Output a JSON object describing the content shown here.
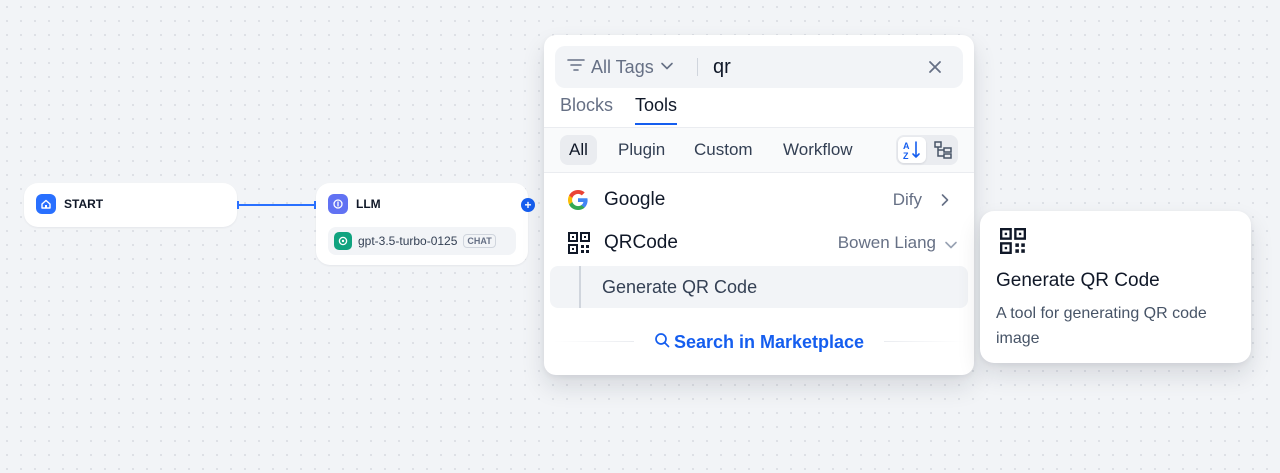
{
  "canvas": {
    "start_node": {
      "title": "START",
      "icon": "home-icon",
      "color": "#2970ff"
    },
    "llm_node": {
      "title": "LLM",
      "icon": "llm-brain-icon",
      "color": "#6172f3",
      "model_icon": "openai-icon",
      "model_name": "gpt-3.5-turbo-0125",
      "model_badge": "CHAT"
    },
    "edge_color": "#2970ff"
  },
  "selector": {
    "tags_label": "All Tags",
    "search_value": "qr",
    "main_tabs": [
      {
        "label": "Blocks",
        "active": false
      },
      {
        "label": "Tools",
        "active": true
      }
    ],
    "sub_tabs": [
      {
        "label": "All",
        "active": true
      },
      {
        "label": "Plugin",
        "active": false
      },
      {
        "label": "Custom",
        "active": false
      },
      {
        "label": "Workflow",
        "active": false
      }
    ],
    "view_modes": [
      "sort-az-icon",
      "tree-view-icon"
    ],
    "results": [
      {
        "name": "Google",
        "author": "Dify",
        "icon": "google-icon",
        "chevron": "chevron-right-icon"
      },
      {
        "name": "QRCode",
        "author": "Bowen Liang",
        "icon": "qrcode-icon",
        "chevron": "chevron-down-icon",
        "tools": [
          {
            "name": "Generate QR Code"
          }
        ]
      }
    ],
    "marketplace_label": "Search in Marketplace",
    "accent": "#155eef"
  },
  "tooltip": {
    "icon": "qrcode-icon",
    "title": "Generate QR Code",
    "description": "A tool for generating QR code image"
  }
}
